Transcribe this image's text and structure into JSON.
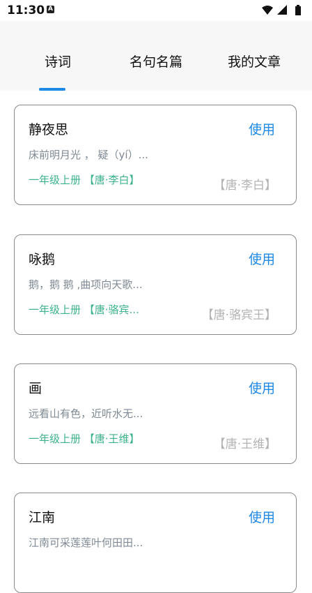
{
  "status": {
    "time": "11:30",
    "a_badge": "A",
    "icons": [
      "wifi-icon",
      "signal-icon",
      "battery-icon"
    ]
  },
  "tabs": [
    {
      "label": "诗词",
      "active": true
    },
    {
      "label": "名句名篇",
      "active": false
    },
    {
      "label": "我的文章",
      "active": false
    }
  ],
  "accent_color": "#1e88e5",
  "grade_color": "#3db28a",
  "cards": [
    {
      "title": "静夜思",
      "use": "使用",
      "excerpt": "床前明月光 ， 疑（yí）...",
      "grade": "一年级上册 【唐·李白】",
      "author": "【唐·李白】"
    },
    {
      "title": "咏鹅",
      "use": "使用",
      "excerpt": "鹅，鹅 鹅 ,曲项向天歌...",
      "grade": "一年级上册 【唐·骆宾...",
      "author": "【唐·骆宾王】"
    },
    {
      "title": "画",
      "use": "使用",
      "excerpt": "远看山有色，近听水无...",
      "grade": "一年级上册 【唐·王维】",
      "author": "【唐·王维】"
    },
    {
      "title": "江南",
      "use": "使用",
      "excerpt": "江南可采莲莲叶何田田...",
      "grade": "",
      "author": ""
    }
  ]
}
